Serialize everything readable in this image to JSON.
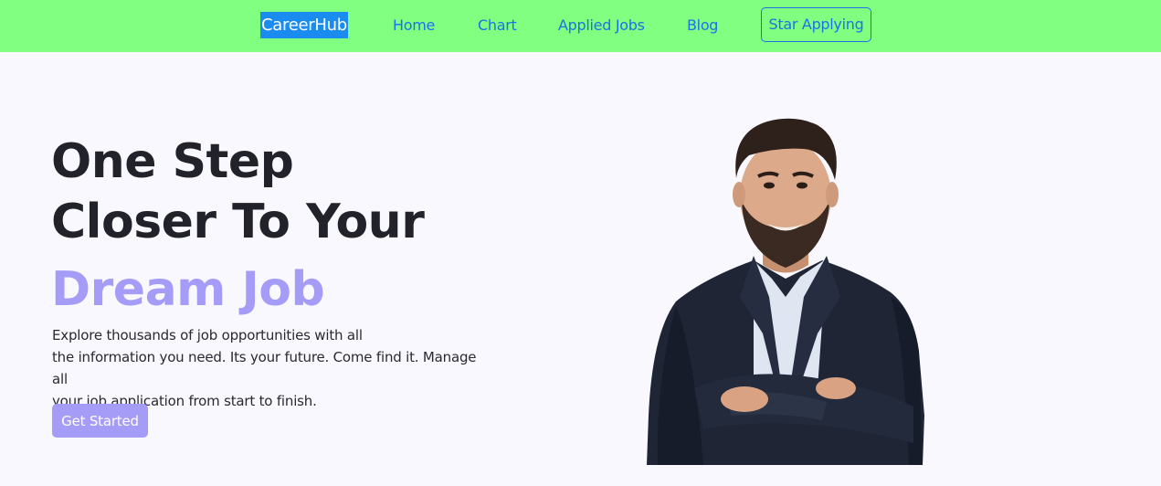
{
  "navbar": {
    "brand": "CareerHub",
    "links": [
      "Home",
      "Chart",
      "Applied Jobs",
      "Blog"
    ],
    "cta": "Star Applying"
  },
  "hero": {
    "title_line1": "One Step",
    "title_line2": "Closer To Your",
    "highlight": "Dream Job",
    "description_line1": "Explore thousands of job opportunities with all",
    "description_line2": "the information you need. Its your future. Come find it. Manage all",
    "description_line3": "your job application from start to finish.",
    "button": "Get Started",
    "image": "smiling-businessman-photo"
  },
  "colors": {
    "navbar_bg": "#80ff80",
    "brand_bg": "#1a8cf0",
    "link": "#1a73e8",
    "accent": "#a59cf8",
    "page_bg": "#f8f8fe",
    "heading": "#22232a"
  }
}
